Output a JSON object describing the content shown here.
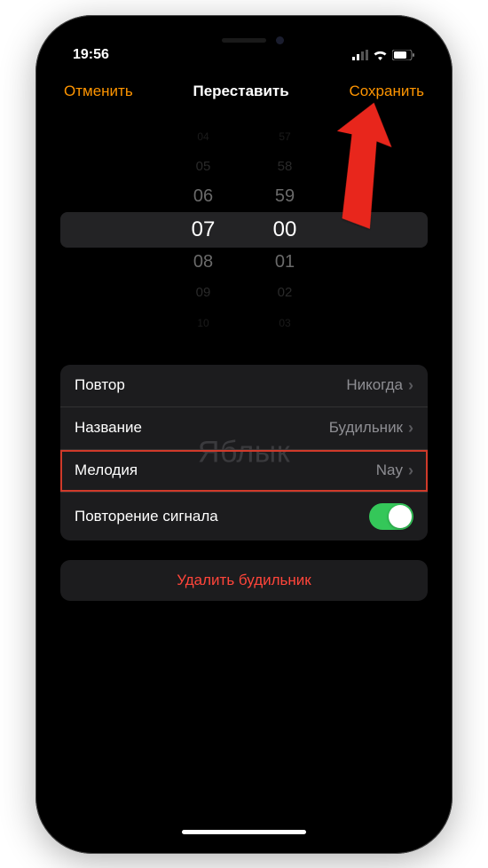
{
  "status": {
    "time": "19:56"
  },
  "nav": {
    "cancel": "Отменить",
    "title": "Переставить",
    "save": "Сохранить"
  },
  "picker": {
    "hours": [
      "04",
      "05",
      "06",
      "07",
      "08",
      "09",
      "10"
    ],
    "minutes": [
      "57",
      "58",
      "59",
      "00",
      "01",
      "02",
      "03"
    ],
    "selected_hour": "07",
    "selected_minute": "00"
  },
  "settings": {
    "repeat": {
      "label": "Повтор",
      "value": "Никогда"
    },
    "name": {
      "label": "Название",
      "value": "Будильник"
    },
    "sound": {
      "label": "Мелодия",
      "value": "Nay"
    },
    "snooze": {
      "label": "Повторение сигнала",
      "on": true
    }
  },
  "delete_label": "Удалить будильник",
  "watermark": "Яблык"
}
